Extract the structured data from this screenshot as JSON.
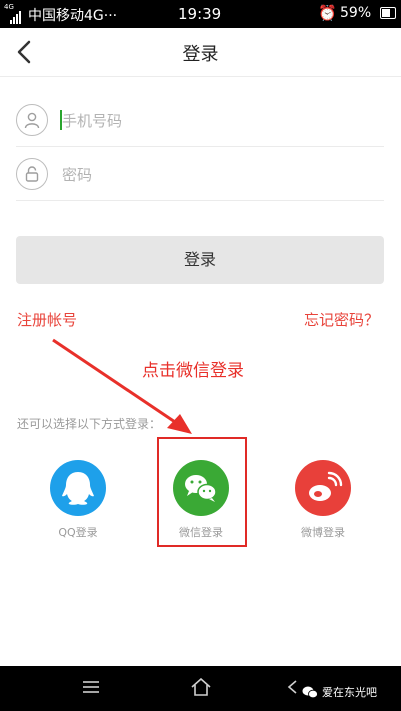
{
  "status_bar": {
    "network": "4G",
    "carrier": "中国移动4G",
    "more": "···",
    "time": "19:39",
    "battery": "59%",
    "icons": [
      "signal-icon",
      "alarm-icon",
      "battery-icon"
    ]
  },
  "header": {
    "title": "登录",
    "back_icon": "back-arrow-icon"
  },
  "form": {
    "phone_placeholder": "手机号码",
    "phone_value": "",
    "password_placeholder": "密码",
    "password_value": "",
    "phone_icon": "user-icon",
    "password_icon": "lock-icon",
    "submit_label": "登录"
  },
  "links": {
    "register": "注册帐号",
    "forgot_password": "忘记密码？"
  },
  "annotation": {
    "text": "点击微信登录",
    "color": "#e8302a"
  },
  "alt_login": {
    "caption": "还可以选择以下方式登录：",
    "options": [
      {
        "label": "QQ登录",
        "icon": "qq-icon",
        "color": "#1ea0ea"
      },
      {
        "label": "微信登录",
        "icon": "wechat-icon",
        "color": "#3aa935"
      },
      {
        "label": "微博登录",
        "icon": "weibo-icon",
        "color": "#e8403a"
      }
    ]
  },
  "bottom_nav": {
    "icons": [
      "menu-icon",
      "home-icon",
      "back-icon"
    ]
  },
  "watermark": {
    "text": "爱在东光吧",
    "icon": "wechat-logo-icon"
  },
  "colors": {
    "accent_red": "#e8443b",
    "wechat_green": "#3aa935",
    "qq_blue": "#1ea0ea",
    "weibo_red": "#e8403a"
  }
}
